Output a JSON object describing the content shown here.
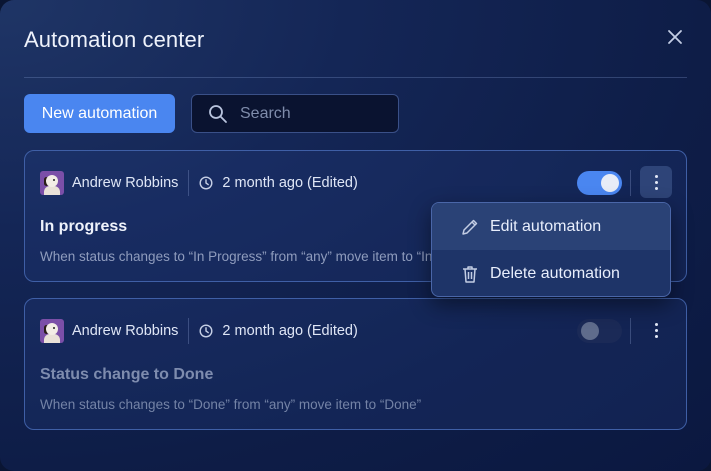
{
  "modal": {
    "title": "Automation center"
  },
  "toolbar": {
    "new_label": "New automation",
    "search_placeholder": "Search"
  },
  "automations": [
    {
      "user": "Andrew Robbins",
      "time": "2 month ago (Edited)",
      "title": "In progress",
      "description": "When status changes to “In Progress” from “any” move item to “In Progress”",
      "enabled": true
    },
    {
      "user": "Andrew Robbins",
      "time": "2 month ago (Edited)",
      "title": "Status change to Done",
      "description": "When status changes to “Done” from “any” move item to “Done”",
      "enabled": false
    }
  ],
  "menu": {
    "edit_label": "Edit automation",
    "delete_label": "Delete automation"
  },
  "colors": {
    "accent": "#4a86f0",
    "card_border": "#3f5fa6",
    "background": "#0e1d47"
  },
  "icons": [
    "close-icon",
    "search-icon",
    "clock-icon",
    "kebab-icon",
    "pencil-icon",
    "trash-icon"
  ]
}
